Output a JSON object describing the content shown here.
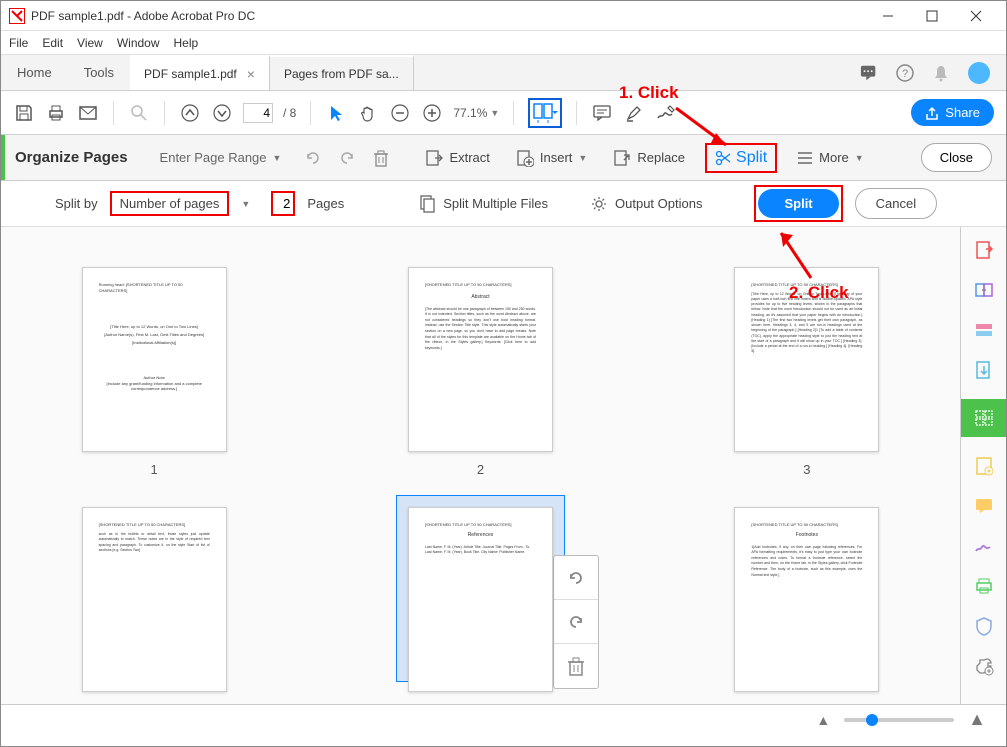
{
  "titlebar": {
    "title": "PDF sample1.pdf - Adobe Acrobat Pro DC"
  },
  "menubar": {
    "file": "File",
    "edit": "Edit",
    "view": "View",
    "window": "Window",
    "help": "Help"
  },
  "tabs": {
    "home": "Home",
    "tools": "Tools",
    "doc1": "PDF sample1.pdf",
    "doc2": "Pages from PDF sa..."
  },
  "toolbar": {
    "page_current": "4",
    "page_total": "/ 8",
    "zoom": "77.1%",
    "share": "Share"
  },
  "organize": {
    "title": "Organize Pages",
    "page_range": "Enter Page Range",
    "extract": "Extract",
    "insert": "Insert",
    "replace": "Replace",
    "split": "Split",
    "more": "More",
    "close": "Close"
  },
  "splitbar": {
    "label": "Split by",
    "mode": "Number of pages",
    "count": "2",
    "pages": "Pages",
    "multi": "Split Multiple Files",
    "output": "Output Options",
    "split": "Split",
    "cancel": "Cancel"
  },
  "thumbs": {
    "p1": "1",
    "p2": "2",
    "p3": "3"
  },
  "annotations": {
    "click1": "1. Click",
    "click2": "2. Click"
  }
}
